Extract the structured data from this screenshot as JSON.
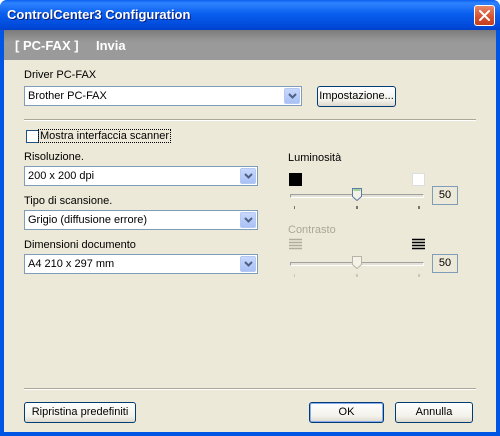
{
  "window": {
    "title": "ControlCenter3 Configuration"
  },
  "banner": {
    "title": "[ PC-FAX ]",
    "subtitle": "Invia"
  },
  "driver": {
    "label": "Driver PC-FAX",
    "value": "Brother PC-FAX",
    "settings_button": "Impostazione..."
  },
  "scanner_interface": {
    "label": "Mostra interfaccia scanner",
    "checked": false
  },
  "resolution": {
    "label": "Risoluzione.",
    "value": "200 x 200 dpi"
  },
  "scan_type": {
    "label": "Tipo di scansione.",
    "value": "Grigio (diffusione errore)"
  },
  "document_size": {
    "label": "Dimensioni documento",
    "value": "A4 210 x 297 mm"
  },
  "brightness": {
    "label": "Luminosità",
    "value": "50",
    "level": 50
  },
  "contrast": {
    "label": "Contrasto",
    "value": "50",
    "level": 50,
    "enabled": false
  },
  "footer": {
    "restore_button": "Ripristina predefiniti",
    "ok_button": "OK",
    "cancel_button": "Annulla"
  }
}
